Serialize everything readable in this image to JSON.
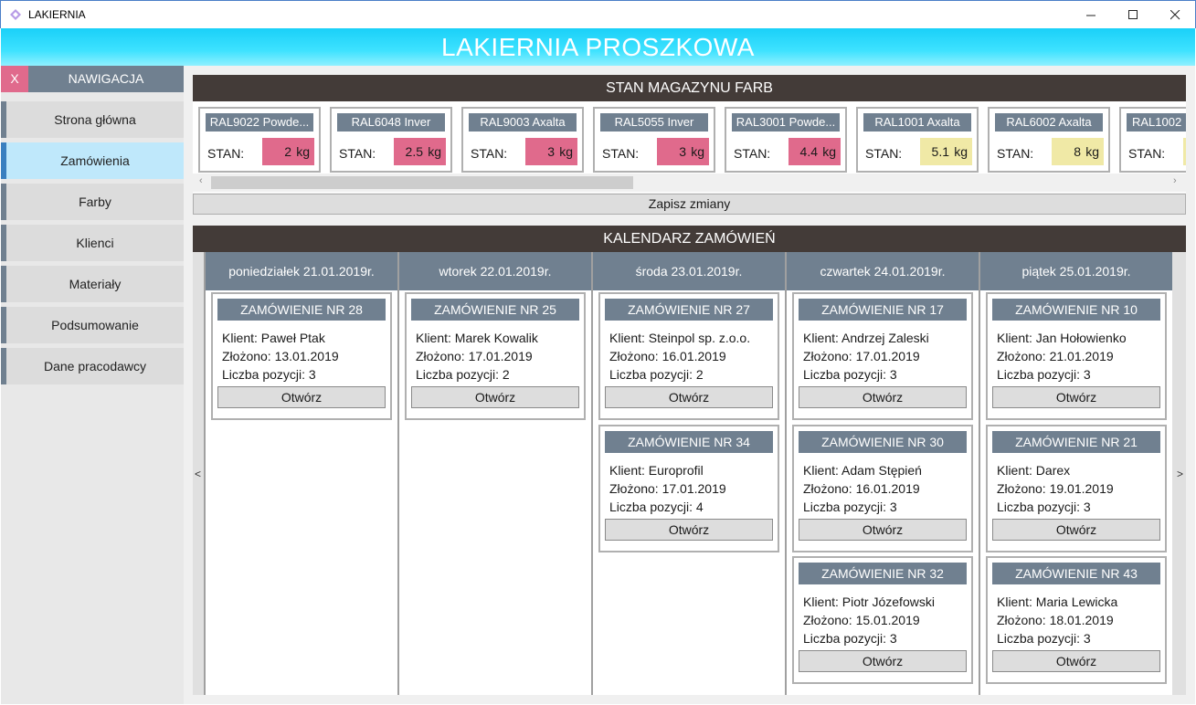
{
  "window": {
    "title": "LAKIERNIA"
  },
  "header": {
    "title": "LAKIERNIA PROSZKOWA"
  },
  "nav": {
    "close_label": "X",
    "title": "NAWIGACJA",
    "items": [
      "Strona główna",
      "Zamówienia",
      "Farby",
      "Klienci",
      "Materiały",
      "Podsumowanie",
      "Dane pracodawcy"
    ],
    "active": "Zamówienia"
  },
  "stock": {
    "title": "STAN MAGAZYNU FARB",
    "stan_label": "STAN:",
    "unit": "kg",
    "items": [
      {
        "name": "RAL9022 Powde...",
        "qty": "2",
        "level": "low"
      },
      {
        "name": "RAL6048 Inver",
        "qty": "2.5",
        "level": "low"
      },
      {
        "name": "RAL9003 Axalta",
        "qty": "3",
        "level": "low"
      },
      {
        "name": "RAL5055 Inver",
        "qty": "3",
        "level": "low"
      },
      {
        "name": "RAL3001 Powde...",
        "qty": "4.4",
        "level": "low"
      },
      {
        "name": "RAL1001 Axalta",
        "qty": "5.1",
        "level": "mid"
      },
      {
        "name": "RAL6002 Axalta",
        "qty": "8",
        "level": "mid"
      },
      {
        "name": "RAL1002",
        "qty": "",
        "level": "mid"
      }
    ],
    "save_label": "Zapisz zmiany"
  },
  "calendar": {
    "title": "KALENDARZ ZAMÓWIEŃ",
    "prev": "<",
    "next": ">",
    "open_label": "Otwórz",
    "days": [
      {
        "label": "poniedziałek 21.01.2019r.",
        "orders": [
          {
            "header": "ZAMÓWIENIE NR 28",
            "client": "Klient: Paweł Ptak",
            "date": "Złożono: 13.01.2019",
            "count": "Liczba pozycji: 3"
          }
        ]
      },
      {
        "label": "wtorek 22.01.2019r.",
        "orders": [
          {
            "header": "ZAMÓWIENIE NR 25",
            "client": "Klient: Marek Kowalik",
            "date": "Złożono: 17.01.2019",
            "count": "Liczba pozycji: 2"
          }
        ]
      },
      {
        "label": "środa 23.01.2019r.",
        "orders": [
          {
            "header": "ZAMÓWIENIE NR 27",
            "client": "Klient: Steinpol sp. z.o.o.",
            "date": "Złożono: 16.01.2019",
            "count": "Liczba pozycji: 2"
          },
          {
            "header": "ZAMÓWIENIE NR 34",
            "client": "Klient: Europrofil",
            "date": "Złożono: 17.01.2019",
            "count": "Liczba pozycji: 4"
          }
        ]
      },
      {
        "label": "czwartek 24.01.2019r.",
        "orders": [
          {
            "header": "ZAMÓWIENIE NR 17",
            "client": "Klient: Andrzej Zaleski",
            "date": "Złożono: 17.01.2019",
            "count": "Liczba pozycji: 3"
          },
          {
            "header": "ZAMÓWIENIE NR 30",
            "client": "Klient: Adam Stępień",
            "date": "Złożono: 16.01.2019",
            "count": "Liczba pozycji: 3"
          },
          {
            "header": "ZAMÓWIENIE NR 32",
            "client": "Klient: Piotr Józefowski",
            "date": "Złożono: 15.01.2019",
            "count": "Liczba pozycji: 3"
          }
        ]
      },
      {
        "label": "piątek 25.01.2019r.",
        "orders": [
          {
            "header": "ZAMÓWIENIE NR 10",
            "client": "Klient: Jan Hołowienko",
            "date": "Złożono: 21.01.2019",
            "count": "Liczba pozycji: 3"
          },
          {
            "header": "ZAMÓWIENIE NR 21",
            "client": "Klient: Darex",
            "date": "Złożono: 19.01.2019",
            "count": "Liczba pozycji: 3"
          },
          {
            "header": "ZAMÓWIENIE NR 43",
            "client": "Klient: Maria Lewicka",
            "date": "Złożono: 18.01.2019",
            "count": "Liczba pozycji: 3"
          }
        ]
      }
    ]
  },
  "colors": {
    "accent": "#1ad0f8",
    "slate": "#708090",
    "dark_bar": "#433b38",
    "low_stock": "#e06a8c",
    "mid_stock": "#f0e9a6",
    "active_nav": "#bfe8fb"
  }
}
